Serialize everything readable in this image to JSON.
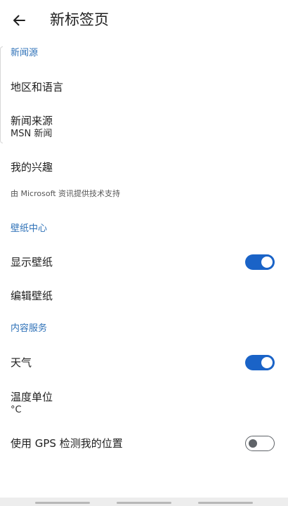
{
  "header": {
    "title": "新标签页"
  },
  "sections": {
    "news": {
      "header": "新闻源",
      "region_language": "地区和语言",
      "source_title": "新闻来源",
      "source_value": "MSN 新闻",
      "interests": "我的兴趣",
      "attribution": "由 Microsoft 资讯提供技术支持"
    },
    "wallpaper": {
      "header": "壁纸中心",
      "show_wallpaper": "显示壁纸",
      "show_wallpaper_on": true,
      "edit_wallpaper": "编辑壁纸"
    },
    "content": {
      "header": "内容服务",
      "weather": "天气",
      "weather_on": true,
      "temp_unit_title": "温度单位",
      "temp_unit_value": "°C",
      "gps": "使用 GPS 检测我的位置",
      "gps_on": false
    }
  },
  "icons": {
    "back": "back-arrow-icon"
  },
  "colors": {
    "accent": "#1a63c7",
    "section_header": "#2f72b8",
    "toggle_off": "#5f6368"
  }
}
